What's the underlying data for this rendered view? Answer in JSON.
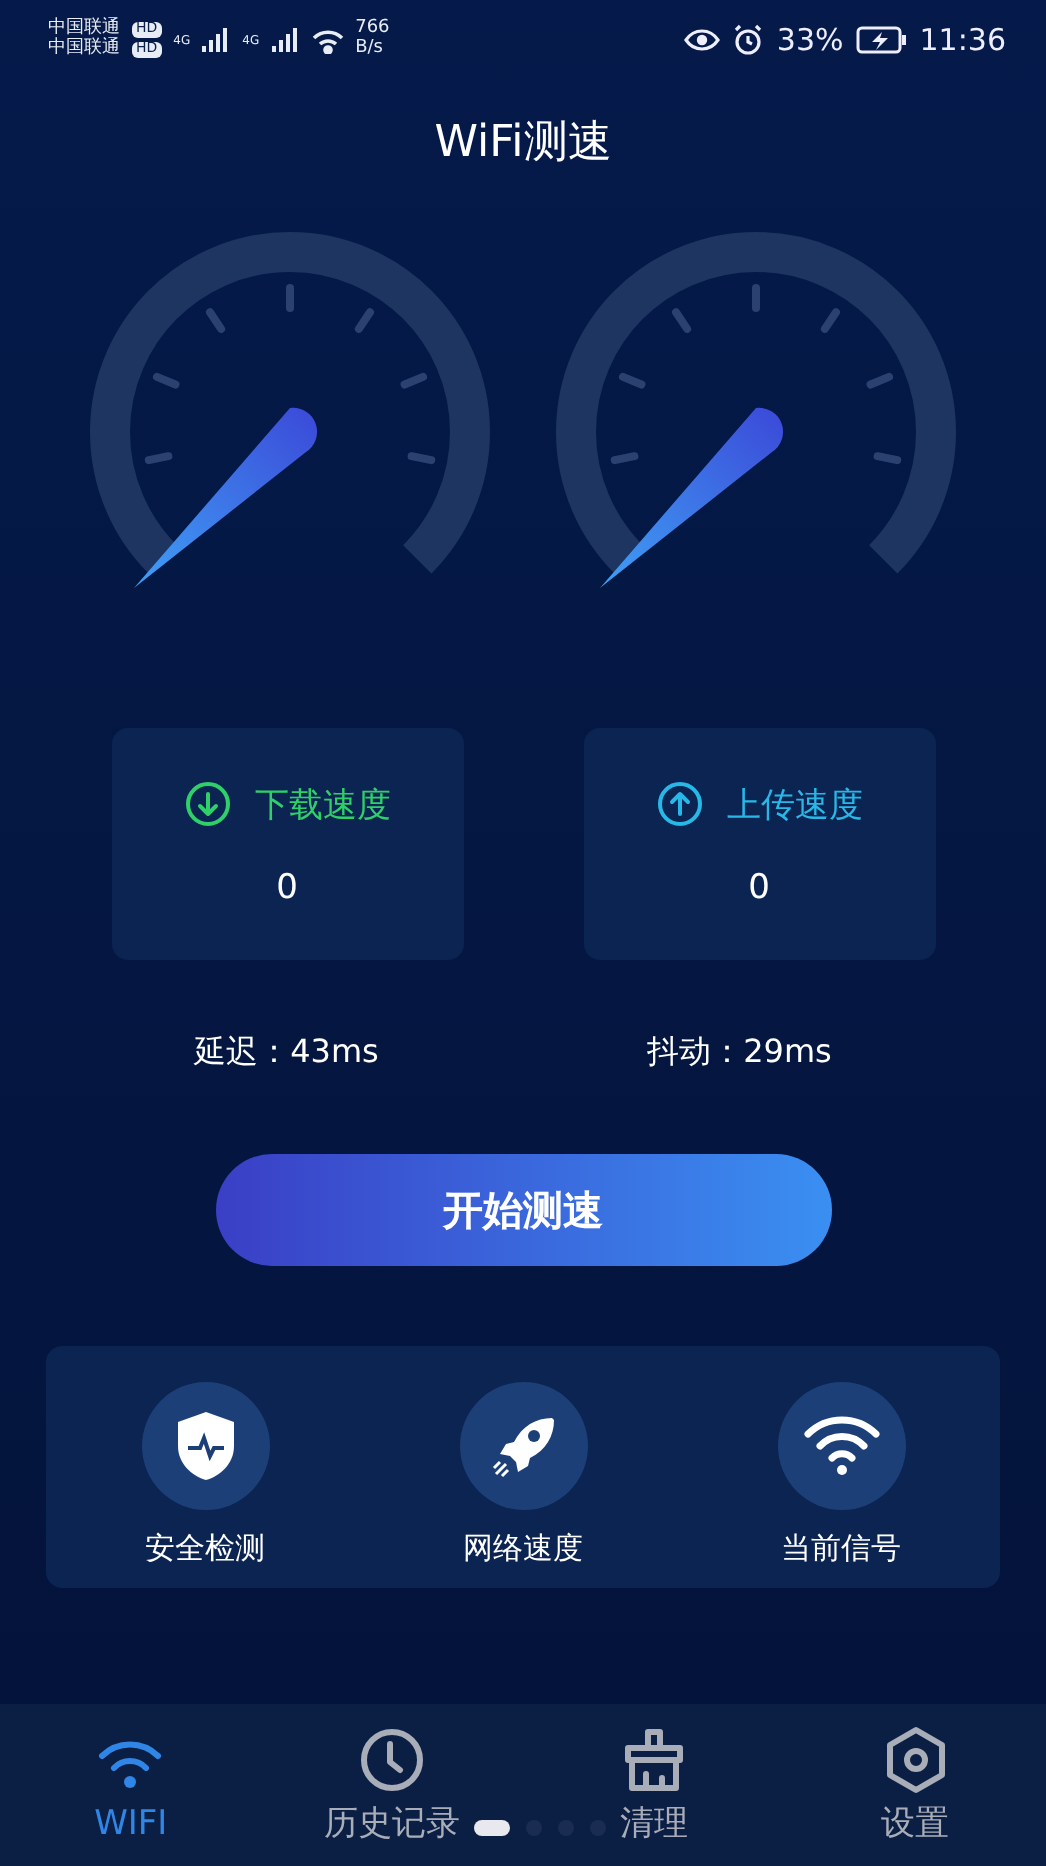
{
  "status_bar": {
    "carrier_1": "中国联通",
    "carrier_2": "中国联通",
    "hd_1": "HD",
    "hd_2": "HD",
    "net_1": "4G",
    "net_2": "4G",
    "speed_value": "766",
    "speed_unit": "B/s",
    "battery": "33%",
    "time": "11:36"
  },
  "title": "WiFi测速",
  "stats": [
    {
      "kind": "download",
      "label": "下载速度",
      "value": "0",
      "color": "#2fd06a"
    },
    {
      "kind": "upload",
      "label": "上传速度",
      "value": "0",
      "color": "#27b8e8"
    }
  ],
  "metrics": [
    {
      "label": "延迟：",
      "value": "43ms"
    },
    {
      "label": "抖动：",
      "value": "29ms"
    }
  ],
  "start_button": "开始测速",
  "tools": [
    {
      "kind": "shield",
      "label": "安全检测"
    },
    {
      "kind": "rocket",
      "label": "网络速度"
    },
    {
      "kind": "wifi",
      "label": "当前信号"
    }
  ],
  "nav": [
    {
      "kind": "wifi",
      "label": "WIFI",
      "selected": true
    },
    {
      "kind": "clock",
      "label": "历史记录",
      "selected": false
    },
    {
      "kind": "brush",
      "label": "清理",
      "selected": false
    },
    {
      "kind": "hexagon",
      "label": "设置",
      "selected": false
    }
  ]
}
